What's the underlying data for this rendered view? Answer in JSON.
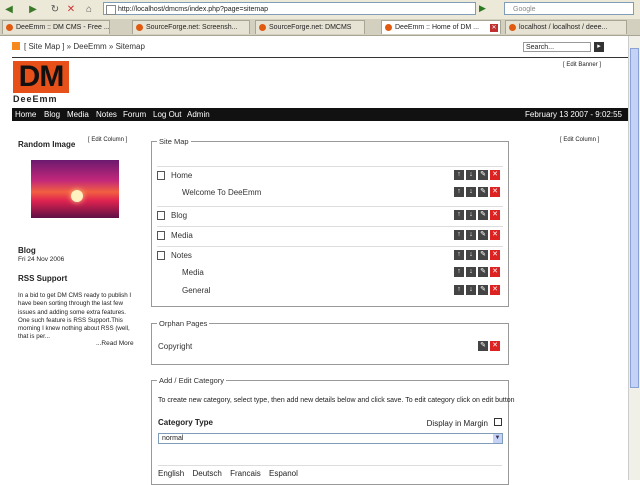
{
  "browser": {
    "url": "http://localhost/dmcms/index.php?page=sitemap",
    "search_placeholder": "Google",
    "tabs": [
      {
        "label": "DeeEmm :: DM CMS - Free ...",
        "active": false
      },
      {
        "label": "SourceForge.net: Screensh...",
        "active": false
      },
      {
        "label": "SourceForge.net: DMCMS",
        "active": false
      },
      {
        "label": "DeeEmm :: Home of DM ...",
        "active": true
      },
      {
        "label": "localhost / localhost / deee...",
        "active": false
      }
    ]
  },
  "header": {
    "breadcrumb": "[ Site Map ] » DeeEmm » Sitemap",
    "search_value": "Search...",
    "edit_banner": "[ Edit Banner ]",
    "logo_text": "DM",
    "logo_sub": "DeeEmm"
  },
  "menu": {
    "items": [
      "Home",
      "Blog",
      "Media",
      "Notes",
      "Forum",
      "Log Out",
      "Admin"
    ],
    "date": "February 13 2007 - 9:02:55"
  },
  "left": {
    "edit_column": "[ Edit Column ]",
    "random_image_title": "Random Image",
    "blog_title": "Blog",
    "blog_date": "Fri 24 Nov 2006",
    "rss_title": "RSS Support",
    "rss_text": "In a bid to get DM CMS ready to publish I have been sorting through the last few issues and adding some extra features. One such feature is RSS Support.This morning I knew nothing about RSS (well, that is per...",
    "read_more": "...Read More"
  },
  "right": {
    "edit_column": "[ Edit Column ]"
  },
  "sitemap": {
    "legend": "Site Map",
    "rows": [
      {
        "label": "Home",
        "level": 0,
        "icon": "page-icon",
        "actions": [
          "up",
          "down",
          "edit",
          "delete"
        ]
      },
      {
        "label": "Welcome To DeeEmm",
        "level": 1,
        "icon": "",
        "actions": [
          "up",
          "down",
          "edit",
          "delete"
        ]
      },
      {
        "label": "Blog",
        "level": 0,
        "icon": "list-icon",
        "actions": [
          "up",
          "down",
          "edit",
          "delete"
        ]
      },
      {
        "label": "Media",
        "level": 0,
        "icon": "image-icon",
        "actions": [
          "up",
          "down",
          "edit",
          "delete"
        ]
      },
      {
        "label": "Notes",
        "level": 0,
        "icon": "page-icon",
        "actions": [
          "up",
          "down",
          "edit",
          "delete"
        ]
      },
      {
        "label": "Media",
        "level": 1,
        "icon": "",
        "actions": [
          "up",
          "down",
          "edit",
          "delete"
        ]
      },
      {
        "label": "General",
        "level": 1,
        "icon": "",
        "actions": [
          "up",
          "down",
          "edit",
          "delete"
        ]
      }
    ]
  },
  "orphan": {
    "legend": "Orphan Pages",
    "rows": [
      {
        "label": "Copyright",
        "actions": [
          "edit",
          "delete"
        ]
      }
    ]
  },
  "addedit": {
    "legend": "Add / Edit Category",
    "instructions": "To create new category, select type, then add new details below and click save. To edit category click on edit button",
    "category_type_label": "Category Type",
    "display_in_margin_label": "Display in Margin",
    "selected_type": "normal"
  },
  "languages": [
    "English",
    "Deutsch",
    "Francais",
    "Espanol"
  ],
  "colors": {
    "accent": "#e8501a",
    "menu_bg": "#111111",
    "delete": "#dd2222"
  }
}
